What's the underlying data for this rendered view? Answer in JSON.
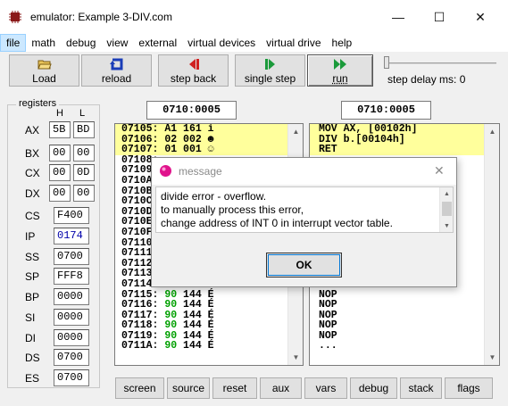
{
  "window": {
    "title": "emulator: Example 3-DIV.com",
    "minimize_glyph": "—",
    "maximize_glyph": "☐",
    "close_glyph": "✕"
  },
  "menu": [
    "file",
    "math",
    "debug",
    "view",
    "external",
    "virtual devices",
    "virtual drive",
    "help"
  ],
  "toolbar": {
    "load": "Load",
    "reload": "reload",
    "step_back": "step back",
    "single_step": "single step",
    "run": "run",
    "step_delay": "step delay ms: 0"
  },
  "registers": {
    "title": "registers",
    "col_h": "H",
    "col_l": "L",
    "byte_regs": [
      {
        "name": "AX",
        "h": "5B",
        "l": "BD"
      },
      {
        "name": "BX",
        "h": "00",
        "l": "00"
      },
      {
        "name": "CX",
        "h": "00",
        "l": "0D"
      },
      {
        "name": "DX",
        "h": "00",
        "l": "00"
      }
    ],
    "word_regs": [
      {
        "name": "CS",
        "value": "F400"
      },
      {
        "name": "IP",
        "value": "0174"
      },
      {
        "name": "SS",
        "value": "0700"
      },
      {
        "name": "SP",
        "value": "FFF8"
      },
      {
        "name": "BP",
        "value": "0000"
      },
      {
        "name": "SI",
        "value": "0000"
      },
      {
        "name": "DI",
        "value": "0000"
      },
      {
        "name": "DS",
        "value": "0700"
      },
      {
        "name": "ES",
        "value": "0700"
      }
    ]
  },
  "memory": {
    "address": "0710:0005",
    "rows": [
      {
        "addr": "07105:",
        "hex": "A1",
        "dec": "161",
        "ch": "í"
      },
      {
        "addr": "07106:",
        "hex": "02",
        "dec": "002",
        "ch": "☻"
      },
      {
        "addr": "07107:",
        "hex": "01",
        "dec": "001",
        "ch": "☺"
      },
      {
        "addr": "07108:",
        "hex": "",
        "dec": "",
        "ch": ""
      },
      {
        "addr": "07109:",
        "hex": "",
        "dec": "",
        "ch": ""
      },
      {
        "addr": "0710A:",
        "hex": "",
        "dec": "",
        "ch": ""
      },
      {
        "addr": "0710B:",
        "hex": "",
        "dec": "",
        "ch": ""
      },
      {
        "addr": "0710C:",
        "hex": "",
        "dec": "",
        "ch": ""
      },
      {
        "addr": "0710D:",
        "hex": "",
        "dec": "",
        "ch": ""
      },
      {
        "addr": "0710E:",
        "hex": "",
        "dec": "",
        "ch": ""
      },
      {
        "addr": "0710F:",
        "hex": "",
        "dec": "",
        "ch": ""
      },
      {
        "addr": "07110:",
        "hex": "",
        "dec": "",
        "ch": ""
      },
      {
        "addr": "07111:",
        "hex": "",
        "dec": "",
        "ch": ""
      },
      {
        "addr": "07112:",
        "hex": "",
        "dec": "",
        "ch": ""
      },
      {
        "addr": "07113:",
        "hex": "",
        "dec": "",
        "ch": ""
      },
      {
        "addr": "07114:",
        "hex": "90",
        "dec": "144",
        "ch": "É"
      },
      {
        "addr": "07115:",
        "hex": "90",
        "dec": "144",
        "ch": "É"
      },
      {
        "addr": "07116:",
        "hex": "90",
        "dec": "144",
        "ch": "É"
      },
      {
        "addr": "07117:",
        "hex": "90",
        "dec": "144",
        "ch": "É"
      },
      {
        "addr": "07118:",
        "hex": "90",
        "dec": "144",
        "ch": "É"
      },
      {
        "addr": "07119:",
        "hex": "90",
        "dec": "144",
        "ch": "É"
      },
      {
        "addr": "0711A:",
        "hex": "90",
        "dec": "144",
        "ch": "É"
      }
    ]
  },
  "disasm": {
    "address": "0710:0005",
    "rows": [
      "MOV AX, [00102h]",
      "DIV b.[00104h]",
      "RET",
      "",
      "",
      "",
      "",
      "",
      "",
      "",
      "",
      "",
      "",
      "NOP",
      "NOP",
      "NOP",
      "NOP",
      "NOP",
      "NOP",
      "NOP",
      "NOP",
      "..."
    ]
  },
  "bottom_buttons": [
    "screen",
    "source",
    "reset",
    "aux",
    "vars",
    "debug",
    "stack",
    "flags"
  ],
  "dialog": {
    "title": "message",
    "close_glyph": "✕",
    "lines": [
      "divide error - overflow.",
      "to manually process this error,",
      "change address of INT 0 in interrupt vector table."
    ],
    "ok": "OK"
  },
  "colors": {
    "highlight": "#ffff9c",
    "hex_green": "#00a000",
    "ip_blue": "#0000aa"
  }
}
